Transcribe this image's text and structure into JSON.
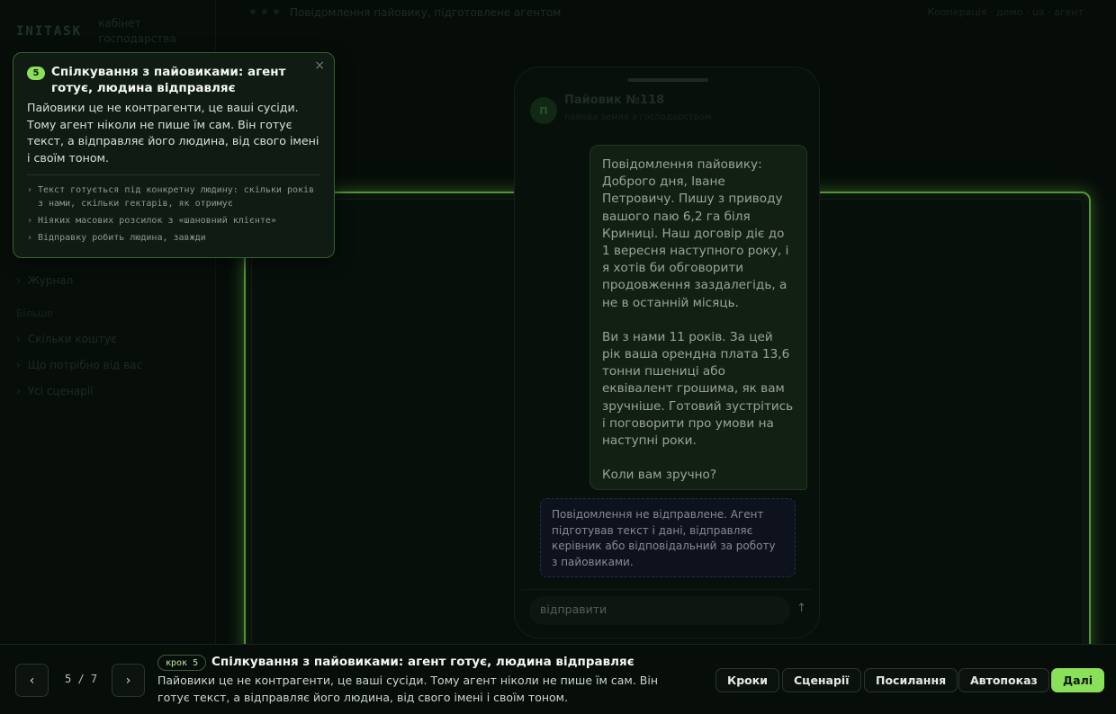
{
  "app": {
    "logo": "INITASK",
    "subtitle": "кабінет господарства",
    "breadcrumb": "Повідомлення пайовику, підготовлене агентом",
    "top_right": "Кооперація · демо · ua · агент"
  },
  "sidebar": {
    "items": [
      {
        "label": "Журнал"
      }
    ],
    "section": "Більше",
    "items2": [
      {
        "label": "Скільки коштує"
      },
      {
        "label": "Що потрібно від вас"
      },
      {
        "label": "Усі сценарії"
      }
    ]
  },
  "chat": {
    "avatar": "П",
    "name": "Пайовик №118",
    "subtitle": "пайова земля з господарством",
    "message": [
      "Повідомлення пайовику: Доброго дня, Іване Петровичу. Пишу з приводу вашого паю 6,2 га біля Криниці. Наш договір діє до 1 вересня наступного року, і я хотів би обговорити продовження заздалегідь, а не в останній місяць.",
      "Ви з нами 11 років. За цей рік ваша орендна плата 13,6 тонни пшениці або еквівалент грошима, як вам зручніше. Готовий зустрітись і поговорити про умови на наступні роки.",
      "Коли вам зручно?"
    ],
    "notice": "Повідомлення не відправлене. Агент підготував текст і дані, відправляє керівник або відповідальний за роботу з пайовиками.",
    "composer_placeholder": "відправити",
    "send_icon": "↑"
  },
  "tooltip": {
    "step_number": "5",
    "title": "Спілкування з пайовиками: агент готує, людина відправляє",
    "body": "Пайовики це не контрагенти, це ваші сусіди. Тому агент ніколи не пише їм сам. Він готує текст, а відправляє його людина, від свого імені і своїм тоном.",
    "points": [
      "Текст готується під конкретну людину: скільки років з нами, скільки гектарів, як отримує",
      "Ніяких масових розсилок з «шановний клієнте»",
      "Відправку робить людина, завжди"
    ],
    "close_icon": "×"
  },
  "tourbar": {
    "prev_icon": "‹",
    "next_icon": "›",
    "counter": "5 / 7",
    "step_label": "крок 5",
    "title": "Спілкування з пайовиками: агент готує, людина відправляє",
    "description": "Пайовики це не контрагенти, це ваші сусіди. Тому агент ніколи не пише їм сам. Він готує текст, а відправляє його людина, від свого імені і своїм тоном.",
    "buttons": {
      "steps": "Кроки",
      "scenarios": "Сценарії",
      "links": "Посилання",
      "autoplay": "Автопоказ",
      "next": "Далі"
    }
  },
  "colors": {
    "accent": "#8be05a",
    "highlight_border": "#7fe04b",
    "notice_border": "#3d3f6a"
  }
}
